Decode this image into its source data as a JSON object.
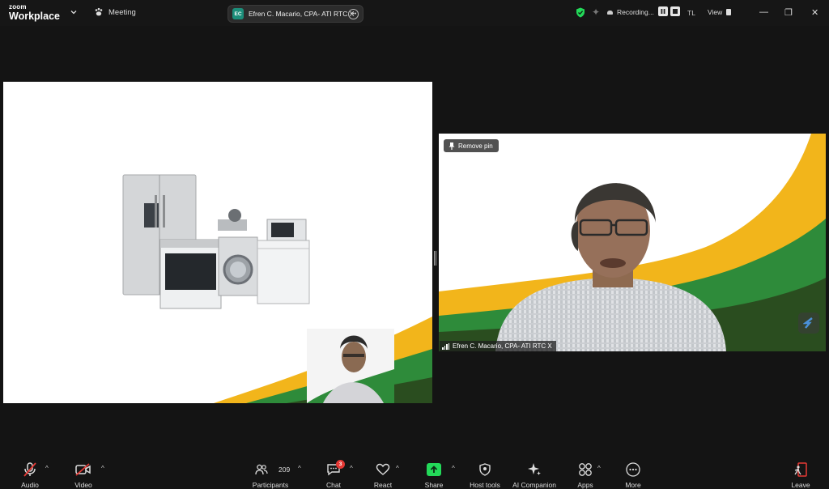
{
  "app": {
    "logo_line1": "zoom",
    "logo_line2": "Workplace",
    "meeting_label": "Meeting",
    "host_pill": {
      "initials": "EC",
      "name": "Efren C. Macario, CPA- ATI RTC X",
      "color": "#1c8e7a"
    },
    "recording_label": "Recording...",
    "language_code": "TL",
    "view_label": "View"
  },
  "video": {
    "remove_pin_label": "Remove pin",
    "speaker_name": "Efren C. Macario, CPA- ATI RTC X"
  },
  "toolbar": {
    "audio_label": "Audio",
    "video_label": "Video",
    "participants_label": "Participants",
    "participants_count": "209",
    "chat_label": "Chat",
    "chat_badge": "3",
    "react_label": "React",
    "share_label": "Share",
    "host_tools_label": "Host tools",
    "ai_companion_label": "AI Companion",
    "apps_label": "Apps",
    "more_label": "More",
    "leave_label": "Leave"
  },
  "colors": {
    "background": "#141414",
    "accent_green": "#23d959",
    "danger_red": "#e53935",
    "slide_yellow": "#f2b51b",
    "slide_green": "#2e8b3a",
    "slide_dark_green": "#2a4d1f"
  },
  "icons": [
    "chevron-down-icon",
    "paw-icon",
    "more-icon",
    "shield-check-icon",
    "sparkle-icon",
    "cloud-record-icon",
    "pause-icon",
    "stop-icon",
    "view-icon",
    "minimize-icon",
    "restore-icon",
    "close-icon",
    "pin-icon",
    "signal-bars-icon",
    "mic-muted-icon",
    "video-off-icon",
    "participants-icon",
    "chat-icon",
    "heart-icon",
    "share-arrow-icon",
    "host-tools-shield-icon",
    "ai-sparkle-icon",
    "apps-icon",
    "more-dots-icon",
    "leave-door-icon"
  ]
}
